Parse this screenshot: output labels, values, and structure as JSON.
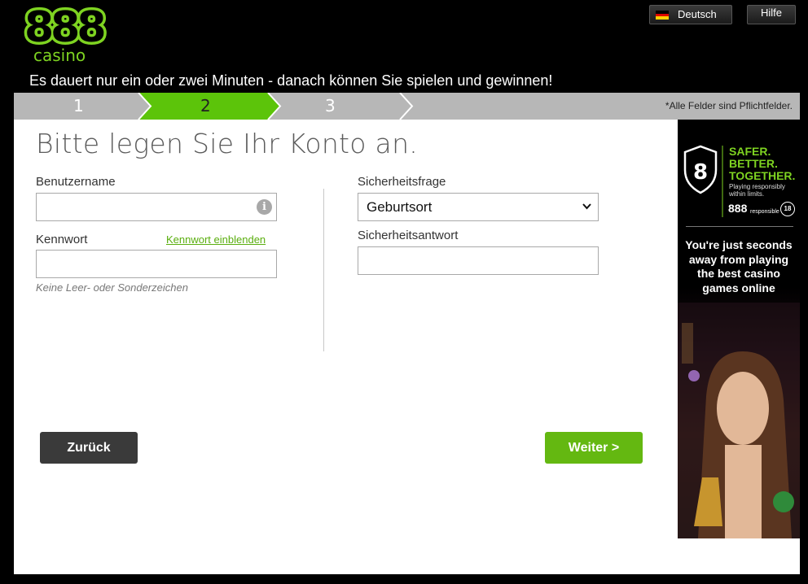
{
  "header": {
    "language_label": "Deutsch",
    "help_label": "Hilfe",
    "tagline": "Es dauert nur ein oder zwei Minuten - danach können Sie spielen und gewinnen!",
    "logo": {
      "number": "888",
      "word": "casino"
    }
  },
  "steps": {
    "items": [
      {
        "label": "1"
      },
      {
        "label": "2"
      },
      {
        "label": "3"
      }
    ],
    "active_index": 1,
    "required_note": "*Alle Felder sind Pflichtfelder."
  },
  "form": {
    "title": "Bitte legen Sie Ihr Konto an.",
    "username": {
      "label": "Benutzername",
      "value": "",
      "placeholder": ""
    },
    "password": {
      "label": "Kennwort",
      "value": "",
      "show_link": "Kennwort einblenden",
      "hint": "Keine Leer- oder Sonderzeichen"
    },
    "security_question": {
      "label": "Sicherheitsfrage",
      "selected": "Geburtsort"
    },
    "security_answer": {
      "label": "Sicherheitsantwort",
      "value": ""
    },
    "back_label": "Zurück",
    "next_label": "Weiter >"
  },
  "banner": {
    "slogan_1": "SAFER.",
    "slogan_2": "BETTER.",
    "slogan_3": "TOGETHER.",
    "small_1": "Playing responsibly",
    "small_2": "within limits.",
    "brand": "888",
    "brand_sub": "responsible",
    "age": "18",
    "text_1": "You're just seconds",
    "text_2": "away from playing",
    "text_3": "the best casino",
    "text_4": "games online"
  },
  "colors": {
    "brand_green": "#7ed321",
    "active_step": "#5cc40a",
    "next_button": "#64b811",
    "back_button": "#3a3a3a"
  },
  "icons": {
    "info": "info-icon",
    "flag": "flag-germany-icon",
    "dropdown": "chevron-down-icon",
    "shield": "shield-8-icon"
  }
}
